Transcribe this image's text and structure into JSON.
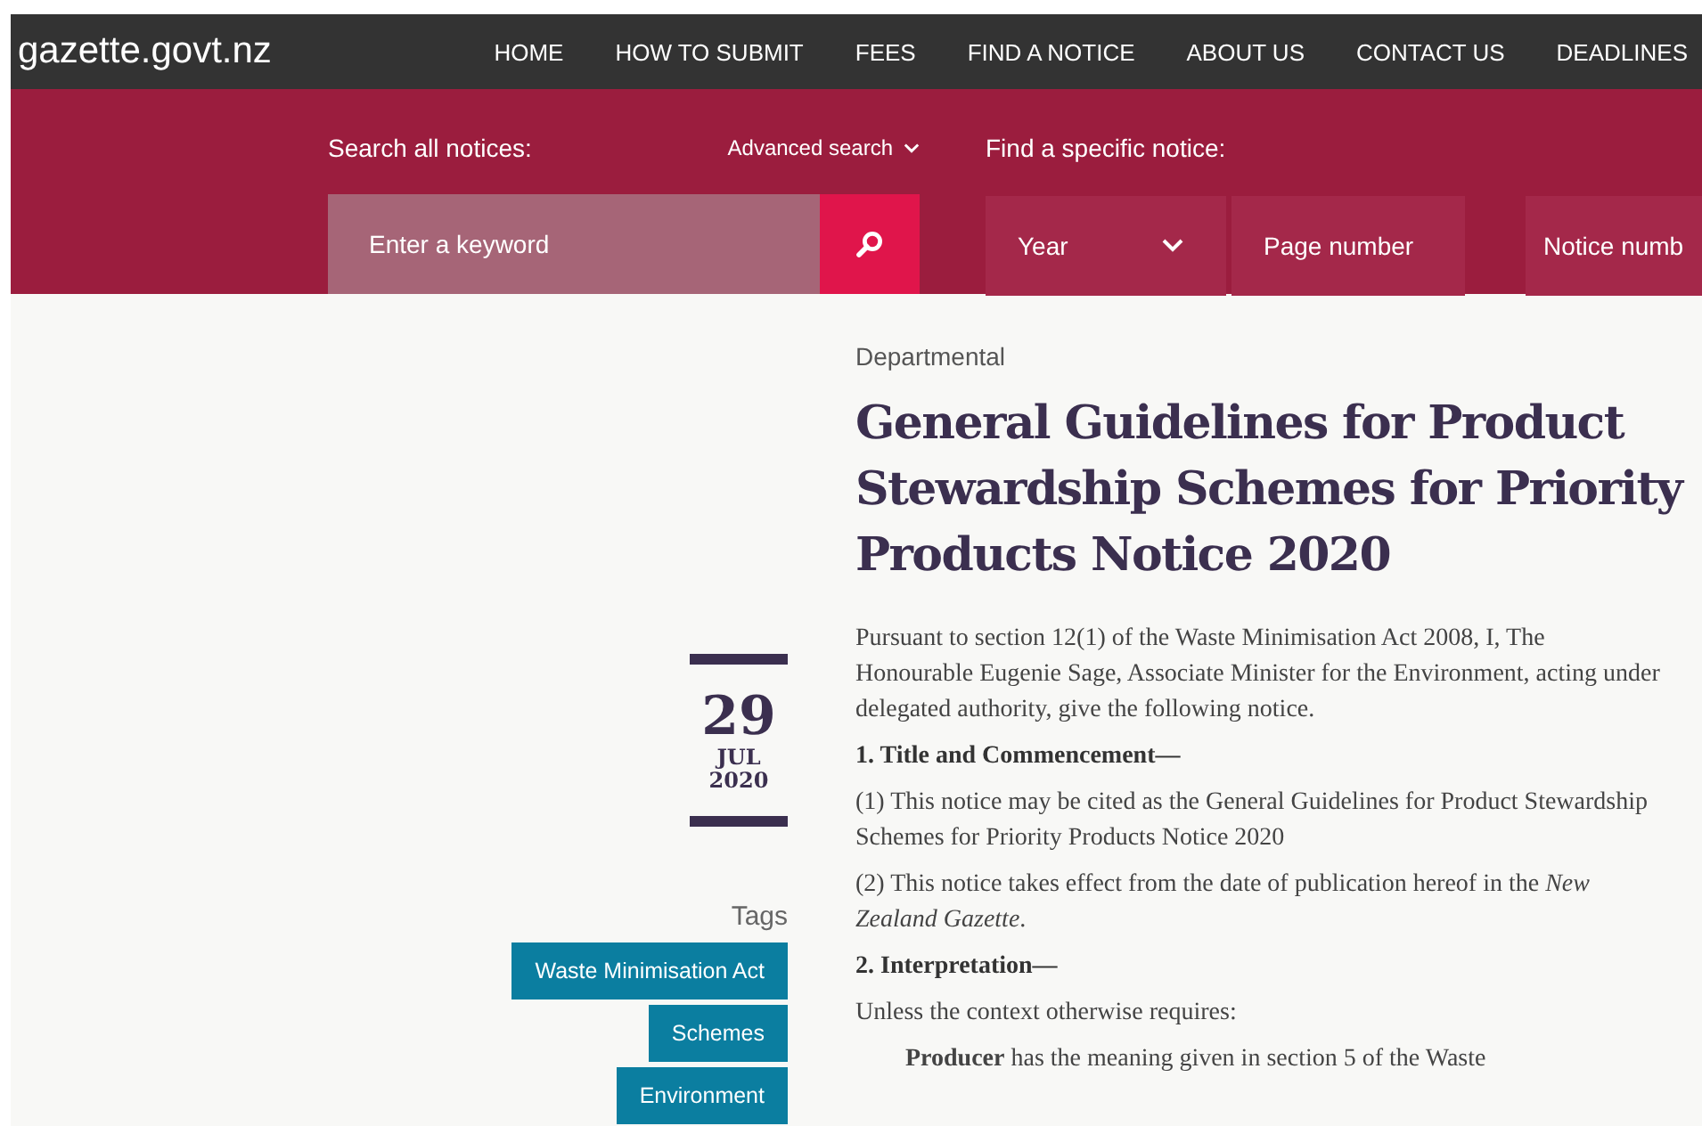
{
  "header": {
    "logo": "gazette.govt.nz",
    "nav": [
      {
        "label": "HOME"
      },
      {
        "label": "HOW TO SUBMIT"
      },
      {
        "label": "FEES"
      },
      {
        "label": "FIND A NOTICE"
      },
      {
        "label": "ABOUT US"
      },
      {
        "label": "CONTACT US"
      },
      {
        "label": "DEADLINES"
      }
    ]
  },
  "search": {
    "label": "Search all notices:",
    "advanced": "Advanced search",
    "placeholder": "Enter a keyword",
    "specific_label": "Find a specific notice:",
    "year": "Year",
    "page_placeholder": "Page number",
    "notice_placeholder": "Notice numb"
  },
  "date": {
    "day": "29",
    "month": "JUL",
    "year": "2020"
  },
  "tags": {
    "heading": "Tags",
    "items": [
      "Waste Minimisation Act",
      "Schemes",
      "Environment"
    ]
  },
  "notice": {
    "category": "Departmental",
    "title": "General Guidelines for Product Stewardship Schemes for Priority Products Notice 2020",
    "body": [
      {
        "kind": "para",
        "text": "Pursuant to section 12(1) of the Waste Minimisation Act 2008, I, The Honourable Eugenie Sage, Associate Minister for the Environment, acting under delegated authority, give the following notice."
      },
      {
        "kind": "heading",
        "text": "1. Title and Commencement—"
      },
      {
        "kind": "para",
        "text": "(1) This notice may be cited as the General Guidelines for Product Stewardship Schemes for Priority Products Notice 2020"
      },
      {
        "kind": "para",
        "text": "(2) This notice takes effect from the date of publication hereof in the *New Zealand Gazette*."
      },
      {
        "kind": "heading",
        "text": "2. Interpretation—"
      },
      {
        "kind": "para",
        "text": "Unless the context otherwise requires:"
      },
      {
        "kind": "definition",
        "text": "**Producer** has the meaning given in section 5 of the Waste"
      }
    ]
  }
}
